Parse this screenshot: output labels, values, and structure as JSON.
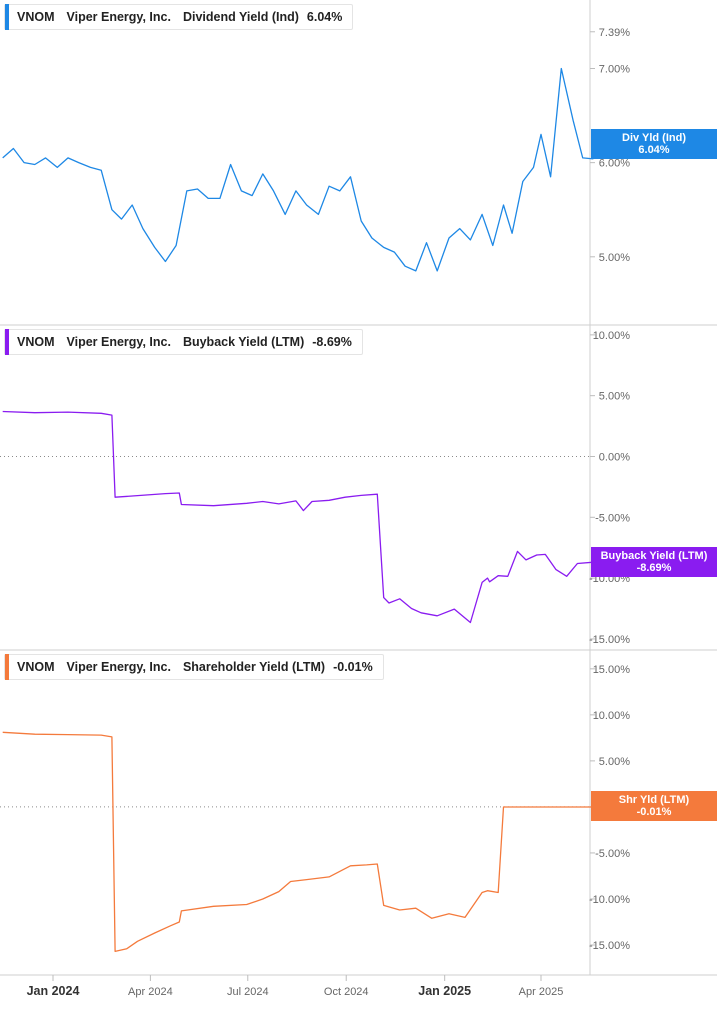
{
  "colors": {
    "div_yield": "#1e88e5",
    "buyback_yield": "#8a1cf0",
    "shareholder_yield": "#f47a3c",
    "grid": "#d0d0d0",
    "axis_text": "#666666"
  },
  "x_axis": {
    "ticks": [
      "Jan 2024",
      "Apr 2024",
      "Jul 2024",
      "Oct 2024",
      "Jan 2025",
      "Apr 2025"
    ],
    "major": [
      "Jan 2024",
      "Jan 2025"
    ]
  },
  "chart_data": [
    {
      "type": "line",
      "ticker": "VNOM",
      "company": "Viper Energy, Inc.",
      "metric": "Dividend Yield (Ind)",
      "last_value": "6.04%",
      "badge": {
        "line1": "Div Yld (Ind)",
        "line2": "6.04%"
      },
      "y_ticks": [
        "7.39%",
        "7.00%",
        "6.00%",
        "5.00%"
      ],
      "ylim": [
        4.35,
        7.6
      ],
      "series": [
        {
          "x": [
            "2023-11-15",
            "2023-11-25",
            "2023-12-05",
            "2023-12-15",
            "2023-12-25",
            "2024-01-05",
            "2024-01-15",
            "2024-01-25",
            "2024-02-05",
            "2024-02-15",
            "2024-02-25",
            "2024-03-05",
            "2024-03-15",
            "2024-03-25",
            "2024-04-05",
            "2024-04-15",
            "2024-04-25",
            "2024-05-05",
            "2024-05-15",
            "2024-05-25",
            "2024-06-05",
            "2024-06-15",
            "2024-06-25",
            "2024-07-05",
            "2024-07-15",
            "2024-07-25",
            "2024-08-05",
            "2024-08-15",
            "2024-08-25",
            "2024-09-05",
            "2024-09-15",
            "2024-09-25",
            "2024-10-05",
            "2024-10-15",
            "2024-10-25",
            "2024-11-05",
            "2024-11-15",
            "2024-11-25",
            "2024-12-05",
            "2024-12-15",
            "2024-12-25",
            "2025-01-05",
            "2025-01-15",
            "2025-01-25",
            "2025-02-05",
            "2025-02-15",
            "2025-02-25",
            "2025-03-05",
            "2025-03-15",
            "2025-03-25",
            "2025-04-01",
            "2025-04-10",
            "2025-04-20",
            "2025-05-01",
            "2025-05-10",
            "2025-05-20"
          ],
          "values": [
            6.05,
            6.15,
            6.0,
            5.98,
            6.05,
            5.95,
            6.05,
            6.0,
            5.95,
            5.92,
            5.5,
            5.4,
            5.55,
            5.3,
            5.1,
            4.95,
            5.12,
            5.7,
            5.72,
            5.62,
            5.62,
            5.98,
            5.7,
            5.65,
            5.88,
            5.7,
            5.45,
            5.7,
            5.55,
            5.45,
            5.75,
            5.7,
            5.85,
            5.38,
            5.2,
            5.1,
            5.05,
            4.9,
            4.85,
            5.15,
            4.85,
            5.2,
            5.3,
            5.18,
            5.45,
            5.12,
            5.55,
            5.25,
            5.8,
            5.95,
            6.3,
            5.85,
            7.0,
            6.45,
            6.05,
            6.04
          ]
        }
      ]
    },
    {
      "type": "line",
      "ticker": "VNOM",
      "company": "Viper Energy, Inc.",
      "metric": "Buyback Yield (LTM)",
      "last_value": "-8.69%",
      "badge": {
        "line1": "Buyback Yield (LTM)",
        "line2": "-8.69%"
      },
      "y_ticks": [
        "10.00%",
        "5.00%",
        "0.00%",
        "-5.00%",
        "-10.00%",
        "-15.00%"
      ],
      "ylim": [
        -15.5,
        10.4
      ],
      "series": [
        {
          "x": [
            "2023-11-15",
            "2023-12-15",
            "2024-01-15",
            "2024-02-15",
            "2024-02-25",
            "2024-02-28",
            "2024-03-15",
            "2024-04-15",
            "2024-04-28",
            "2024-04-30",
            "2024-05-30",
            "2024-06-30",
            "2024-07-15",
            "2024-07-30",
            "2024-08-15",
            "2024-08-22",
            "2024-08-30",
            "2024-09-15",
            "2024-09-30",
            "2024-10-15",
            "2024-10-30",
            "2024-11-05",
            "2024-11-10",
            "2024-11-20",
            "2024-12-01",
            "2024-12-10",
            "2024-12-25",
            "2025-01-10",
            "2025-01-25",
            "2025-02-05",
            "2025-02-10",
            "2025-02-12",
            "2025-02-20",
            "2025-03-01",
            "2025-03-10",
            "2025-03-18",
            "2025-03-28",
            "2025-04-05",
            "2025-04-15",
            "2025-04-25",
            "2025-05-05",
            "2025-05-20"
          ],
          "values": [
            3.7,
            3.6,
            3.65,
            3.55,
            3.4,
            -3.35,
            -3.25,
            -3.05,
            -3.0,
            -3.95,
            -4.05,
            -3.85,
            -3.7,
            -3.9,
            -3.65,
            -4.45,
            -3.7,
            -3.6,
            -3.35,
            -3.2,
            -3.1,
            -11.6,
            -12.05,
            -11.7,
            -12.5,
            -12.85,
            -13.1,
            -12.55,
            -13.65,
            -10.35,
            -10.0,
            -10.3,
            -9.8,
            -9.85,
            -7.8,
            -8.5,
            -8.1,
            -8.05,
            -9.3,
            -9.85,
            -8.8,
            -8.69
          ]
        }
      ]
    },
    {
      "type": "line",
      "ticker": "VNOM",
      "company": "Viper Energy, Inc.",
      "metric": "Shareholder Yield (LTM)",
      "last_value": "-0.01%",
      "badge": {
        "line1": "Shr Yld (LTM)",
        "line2": "-0.01%"
      },
      "y_ticks": [
        "15.00%",
        "10.00%",
        "5.00%",
        "0.00%",
        "-5.00%",
        "-10.00%",
        "-15.00%"
      ],
      "ylim": [
        -17.5,
        16.5
      ],
      "series": [
        {
          "x": [
            "2023-11-15",
            "2023-12-15",
            "2024-01-15",
            "2024-02-15",
            "2024-02-25",
            "2024-02-28",
            "2024-03-10",
            "2024-03-20",
            "2024-04-05",
            "2024-04-20",
            "2024-04-28",
            "2024-04-30",
            "2024-05-30",
            "2024-06-30",
            "2024-07-15",
            "2024-07-30",
            "2024-08-10",
            "2024-08-25",
            "2024-09-15",
            "2024-10-05",
            "2024-10-20",
            "2024-10-30",
            "2024-11-05",
            "2024-11-20",
            "2024-12-05",
            "2024-12-20",
            "2025-01-05",
            "2025-01-20",
            "2025-02-05",
            "2025-02-10",
            "2025-02-20",
            "2025-02-25",
            "2025-05-20"
          ],
          "values": [
            8.1,
            7.9,
            7.85,
            7.8,
            7.6,
            -15.7,
            -15.4,
            -14.6,
            -13.7,
            -12.9,
            -12.5,
            -11.3,
            -10.8,
            -10.6,
            -10.0,
            -9.2,
            -8.1,
            -7.9,
            -7.6,
            -6.4,
            -6.3,
            -6.2,
            -10.7,
            -11.2,
            -11.0,
            -12.1,
            -11.6,
            -12.0,
            -9.3,
            -9.1,
            -9.3,
            -0.01,
            -0.01
          ]
        }
      ]
    }
  ]
}
